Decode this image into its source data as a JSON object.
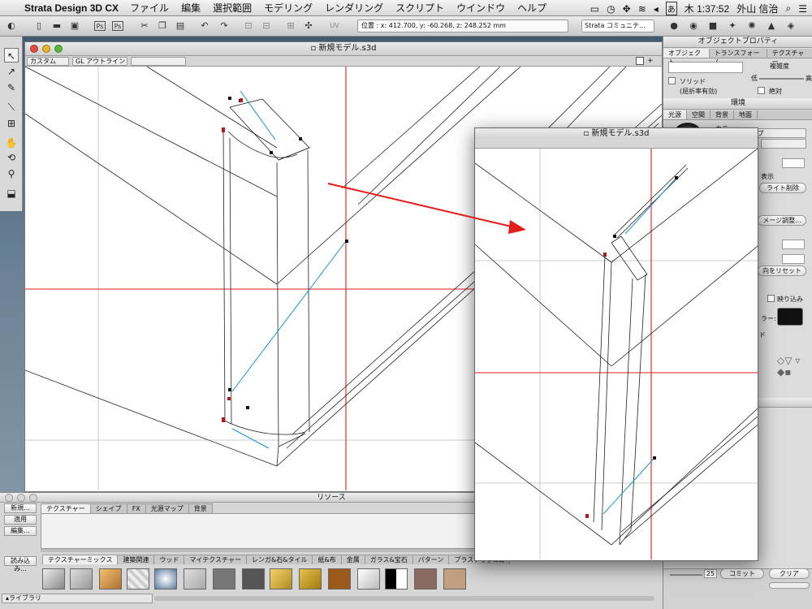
{
  "menubar": {
    "app_name": "Strata Design 3D CX",
    "items": [
      "ファイル",
      "編集",
      "選択範囲",
      "モデリング",
      "レンダリング",
      "スクリプト",
      "ウインドウ",
      "ヘルプ"
    ],
    "ime": "あ",
    "clock": "木 1:37:52",
    "user": "外山 信治"
  },
  "toolbar": {
    "coordinates": "位置 : x: 412.700, y: -60.268, z: 248.252 mm",
    "community_select": "Strata コミュニテ..."
  },
  "main_window": {
    "title": "新規モデル.s3d",
    "view_select": "カスタム",
    "render_select": "GL アウトライン"
  },
  "zoom_window": {
    "title": "新規モデル.s3d"
  },
  "object_properties": {
    "title": "オブジェクトプロパティ",
    "tabs": [
      "オブジェクト",
      "トランスフォーム",
      "テクスチャー"
    ],
    "complexity_label": "複雑度",
    "low_label": "低",
    "high_label": "高",
    "solid_label": "ソリッド",
    "refraction_label": "(屈折率有効)",
    "absolute_label": "絶対"
  },
  "environment": {
    "title": "環境",
    "tabs": [
      "光源",
      "空間",
      "背景",
      "地面"
    ],
    "color_label": "カラー:",
    "fragments": [
      "ープ",
      "表示",
      "ライト削除",
      "メージ調整...",
      "向をリセット",
      "映り込み",
      "ラー:",
      "ド"
    ]
  },
  "bottom_panel": {
    "value": "25",
    "commit_label": "コミット",
    "clear_label": "クリア"
  },
  "resources": {
    "title": "リソース",
    "buttons": [
      "新規...",
      "適用",
      "編集..."
    ],
    "load_button": "読み込み...",
    "tabs": [
      "テクスチャー",
      "シェイプ",
      "FX",
      "光源マップ",
      "背景"
    ],
    "library_tabs": [
      "テクスチャーミックス",
      "建築関連",
      "ウッド",
      "マイテクスチャー",
      "レンガ&石&タイル",
      "紙&布",
      "金属",
      "ガラス&宝石",
      "パターン",
      "プラスチック&ゴ"
    ],
    "library_select": "ライブラリ"
  },
  "colors": {
    "red_guide": "#e31c1c",
    "blue_edge": "#1f8fd6"
  }
}
